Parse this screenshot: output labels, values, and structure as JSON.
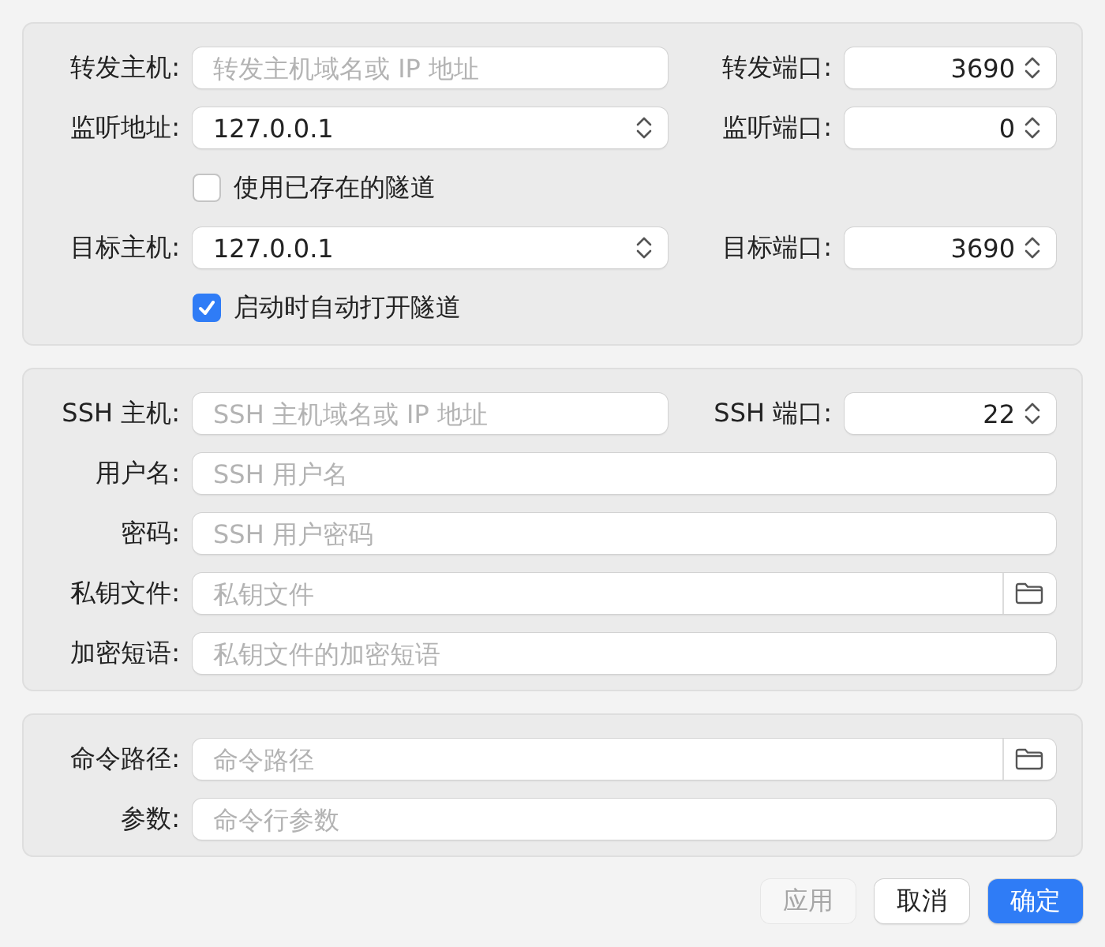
{
  "sections": [
    {
      "rows": [
        {
          "kind": "field",
          "label": "转发主机:",
          "field": {
            "kind": "text",
            "placeholder": "转发主机域名或 IP 地址"
          },
          "side": {
            "label": "转发端口:",
            "value": "3690"
          }
        },
        {
          "kind": "field",
          "label": "监听地址:",
          "field": {
            "kind": "combo",
            "value": "127.0.0.1"
          },
          "side": {
            "label": "监听端口:",
            "value": "0"
          }
        },
        {
          "kind": "checkbox",
          "label": "使用已存在的隧道",
          "checked": false
        },
        {
          "kind": "field",
          "label": "目标主机:",
          "field": {
            "kind": "combo",
            "value": "127.0.0.1"
          },
          "side": {
            "label": "目标端口:",
            "value": "3690"
          }
        },
        {
          "kind": "checkbox",
          "label": "启动时自动打开隧道",
          "checked": true
        }
      ]
    },
    {
      "rows": [
        {
          "kind": "field",
          "label": "SSH 主机:",
          "field": {
            "kind": "text",
            "placeholder": "SSH 主机域名或 IP 地址"
          },
          "side": {
            "label": "SSH 端口:",
            "value": "22"
          }
        },
        {
          "kind": "field",
          "label": "用户名:",
          "field": {
            "kind": "text",
            "placeholder": "SSH 用户名"
          }
        },
        {
          "kind": "field",
          "label": "密码:",
          "field": {
            "kind": "text",
            "placeholder": "SSH 用户密码"
          }
        },
        {
          "kind": "field",
          "label": "私钥文件:",
          "field": {
            "kind": "file",
            "placeholder": "私钥文件"
          }
        },
        {
          "kind": "field",
          "label": "加密短语:",
          "field": {
            "kind": "text",
            "placeholder": "私钥文件的加密短语"
          }
        }
      ]
    },
    {
      "rows": [
        {
          "kind": "field",
          "label": "命令路径:",
          "field": {
            "kind": "file",
            "placeholder": "命令路径"
          }
        },
        {
          "kind": "field",
          "label": "参数:",
          "field": {
            "kind": "text",
            "placeholder": "命令行参数"
          }
        }
      ]
    }
  ],
  "buttons": [
    {
      "label": "应用",
      "primary": false,
      "disabled": true
    },
    {
      "label": "取消",
      "primary": false,
      "disabled": false
    },
    {
      "label": "确定",
      "primary": true,
      "disabled": false
    }
  ]
}
